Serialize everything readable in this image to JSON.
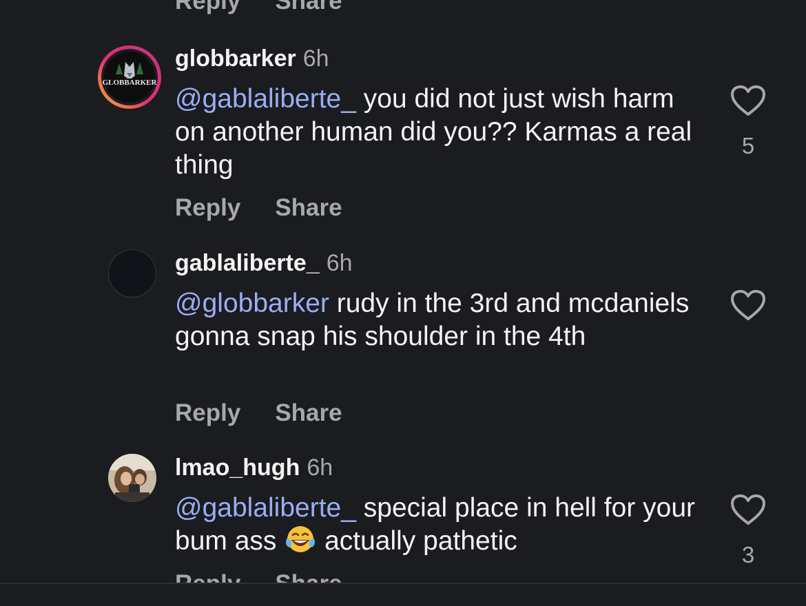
{
  "top_actions": {
    "reply": "Reply",
    "share": "Share"
  },
  "comments": [
    {
      "username": "globbarker",
      "time": "6h",
      "mention": "@gablaliberte_",
      "text": " you did not just wish harm on another human did you?? Karmas a real thing",
      "likes": "5",
      "reply": "Reply",
      "share": "Share",
      "avatar_logo_text": "GLOBBARKER"
    },
    {
      "username": "gablaliberte_",
      "time": "6h",
      "mention": "@globbarker",
      "text": "  rudy in the 3rd and mcdaniels gonna snap his shoulder in the 4th",
      "likes": "",
      "reply": "Reply",
      "share": "Share"
    },
    {
      "username": "lmao_hugh",
      "time": "6h",
      "mention": "@gablaliberte_",
      "text_before_emoji": " special place in hell for your bum ass ",
      "emoji": "face-with-tears-of-joy",
      "text_after_emoji": " actually pathetic",
      "likes": "3",
      "reply": "Reply",
      "share": "Share"
    }
  ],
  "colors": {
    "background": "#1b1c1f",
    "mention": "#9aaef5",
    "secondary_text": "#a7a8ad",
    "primary_text": "#f4f4f4"
  }
}
